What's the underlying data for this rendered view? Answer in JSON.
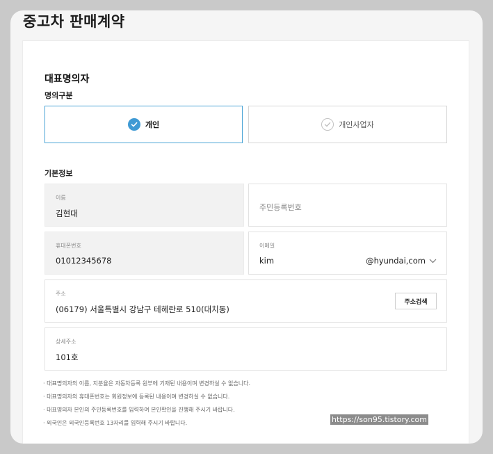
{
  "page": {
    "title": "중고차 판매계약"
  },
  "section": {
    "title": "대표명의자"
  },
  "ownership": {
    "label": "명의구분",
    "options": [
      {
        "label": "개인",
        "selected": true
      },
      {
        "label": "개인사업자",
        "selected": false
      }
    ]
  },
  "basic": {
    "label": "기본정보",
    "name": {
      "label": "이름",
      "value": "김현대"
    },
    "resident_id": {
      "placeholder": "주민등록번호"
    },
    "phone": {
      "label": "휴대폰번호",
      "value": "01012345678"
    },
    "email": {
      "label": "이메일",
      "local": "kim",
      "domain": "@hyundai,com"
    },
    "address": {
      "label": "주소",
      "value": "(06179) 서울특별시 강남구 테헤란로 510(대치동)",
      "button": "주소검색"
    },
    "detail_address": {
      "label": "상세주소",
      "value": "101호"
    }
  },
  "notes": [
    "대표명의자의 이름, 지분율은 자동차등록 원부에 기재된 내용이며 변경하실 수 없습니다.",
    "대표명의자의 휴대폰번호는 회원정보에 등록된 내용이며 변경하실 수 없습니다.",
    "대표명의자 본인의 주민등록번호를 입력하여 본인확인을 진행해 주시기 바랍니다.",
    "외국인은 외국인등록번호 13자리를 입력해 주시기 바랍니다."
  ],
  "watermark": "https://son95.tistory.com",
  "colors": {
    "accent": "#3f9ad4",
    "selected_border": "#4aa4d6",
    "background": "#c9c9c9"
  },
  "icons": {
    "selected": "check-circle-filled-icon",
    "unselected": "check-circle-outline-icon",
    "dropdown": "chevron-down-icon"
  }
}
